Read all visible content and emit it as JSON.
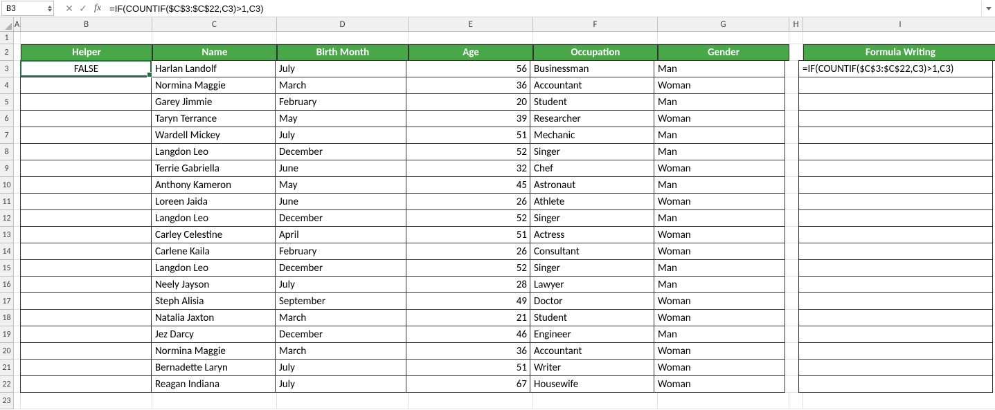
{
  "nameBox": "B3",
  "formula": "=IF(COUNTIF($C$3:$C$22,C3)>1,C3)",
  "columns": [
    "A",
    "B",
    "C",
    "D",
    "E",
    "F",
    "G",
    "H",
    "I"
  ],
  "rowCount": 23,
  "headers": {
    "B": "Helper",
    "C": "Name",
    "D": "Birth Month",
    "E": "Age",
    "F": "Occupation",
    "G": "Gender",
    "I": "Formula Writing"
  },
  "b3": "FALSE",
  "i3": "=IF(COUNTIF($C$3:$C$22,C3)>1,C3)",
  "rows": [
    {
      "name": "Harlan Landolf",
      "month": "July",
      "age": 56,
      "occ": "Businessman",
      "gender": "Man"
    },
    {
      "name": "Normina Maggie",
      "month": "March",
      "age": 36,
      "occ": "Accountant",
      "gender": "Woman"
    },
    {
      "name": "Garey Jimmie",
      "month": "February",
      "age": 20,
      "occ": "Student",
      "gender": "Man"
    },
    {
      "name": "Taryn Terrance",
      "month": "May",
      "age": 39,
      "occ": "Researcher",
      "gender": "Woman"
    },
    {
      "name": "Wardell Mickey",
      "month": "July",
      "age": 51,
      "occ": "Mechanic",
      "gender": "Man"
    },
    {
      "name": "Langdon Leo",
      "month": "December",
      "age": 52,
      "occ": "Singer",
      "gender": "Man"
    },
    {
      "name": "Terrie Gabriella",
      "month": "June",
      "age": 32,
      "occ": "Chef",
      "gender": "Woman"
    },
    {
      "name": "Anthony Kameron",
      "month": "May",
      "age": 45,
      "occ": "Astronaut",
      "gender": "Man"
    },
    {
      "name": "Loreen Jaida",
      "month": "June",
      "age": 26,
      "occ": "Athlete",
      "gender": "Woman"
    },
    {
      "name": "Langdon Leo",
      "month": "December",
      "age": 52,
      "occ": "Singer",
      "gender": "Man"
    },
    {
      "name": "Carley Celestine",
      "month": "April",
      "age": 51,
      "occ": "Actress",
      "gender": "Woman"
    },
    {
      "name": "Carlene Kaila",
      "month": "February",
      "age": 26,
      "occ": "Consultant",
      "gender": "Woman"
    },
    {
      "name": "Langdon Leo",
      "month": "December",
      "age": 52,
      "occ": "Singer",
      "gender": "Man"
    },
    {
      "name": "Neely Jayson",
      "month": "July",
      "age": 28,
      "occ": "Lawyer",
      "gender": "Man"
    },
    {
      "name": "Steph Alisia",
      "month": "September",
      "age": 49,
      "occ": "Doctor",
      "gender": "Woman"
    },
    {
      "name": "Natalia Jaxton",
      "month": "March",
      "age": 21,
      "occ": "Student",
      "gender": "Woman"
    },
    {
      "name": "Jez Darcy",
      "month": "December",
      "age": 46,
      "occ": "Engineer",
      "gender": "Man"
    },
    {
      "name": "Normina Maggie",
      "month": "March",
      "age": 36,
      "occ": "Accountant",
      "gender": "Woman"
    },
    {
      "name": "Bernadette Laryn",
      "month": "July",
      "age": 51,
      "occ": "Writer",
      "gender": "Woman"
    },
    {
      "name": "Reagan Indiana",
      "month": "July",
      "age": 67,
      "occ": "Housewife",
      "gender": "Woman"
    }
  ],
  "selection": {
    "row": 3,
    "col": "B"
  }
}
